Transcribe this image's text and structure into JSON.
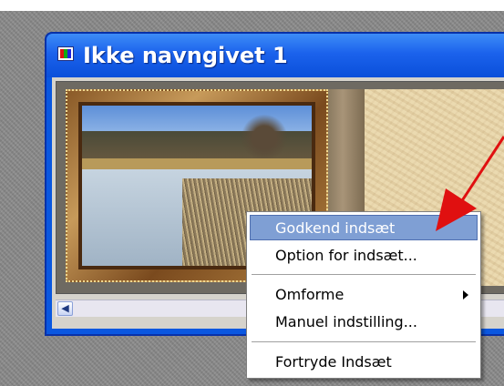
{
  "window": {
    "title": "Ikke navngivet 1"
  },
  "context_menu": {
    "items": [
      {
        "label": "Godkend indsæt",
        "highlighted": true
      },
      {
        "label": "Option for indsæt...",
        "highlighted": false
      },
      {
        "label": "Omforme",
        "highlighted": false,
        "has_submenu": true
      },
      {
        "label": "Manuel indstilling...",
        "highlighted": false
      },
      {
        "label": "Fortryde Indsæt",
        "highlighted": false
      }
    ]
  },
  "icons": {
    "app_icon": "film-strip-icon",
    "scroll_left": "arrow-left-icon",
    "submenu": "chevron-right-icon",
    "annotation": "red-pointer-arrow-icon"
  },
  "colors": {
    "titlebar": "#1b62ec",
    "menu_highlight": "#7f9fd4",
    "annotation_arrow": "#e01010"
  }
}
